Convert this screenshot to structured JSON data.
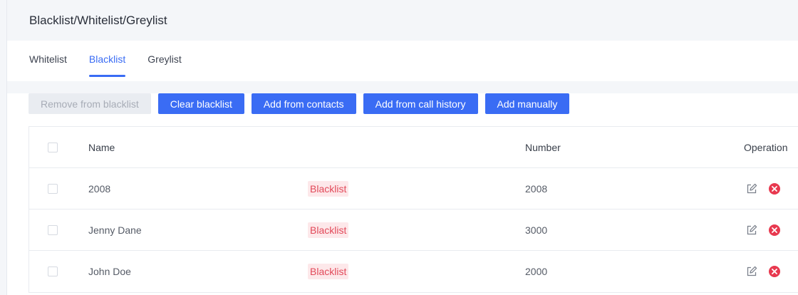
{
  "header": {
    "title": "Blacklist/Whitelist/Greylist"
  },
  "tabs": [
    {
      "label": "Whitelist",
      "active": false
    },
    {
      "label": "Blacklist",
      "active": true
    },
    {
      "label": "Greylist",
      "active": false
    }
  ],
  "toolbar": {
    "remove_label": "Remove from blacklist",
    "clear_label": "Clear blacklist",
    "add_contacts_label": "Add from contacts",
    "add_history_label": "Add from call history",
    "add_manual_label": "Add manually"
  },
  "table": {
    "columns": {
      "name": "Name",
      "number": "Number",
      "operation": "Operation"
    },
    "rows": [
      {
        "name": "2008",
        "tag": "Blacklist",
        "number": "2008"
      },
      {
        "name": "Jenny Dane",
        "tag": "Blacklist",
        "number": "3000"
      },
      {
        "name": "John Doe",
        "tag": "Blacklist",
        "number": "2000"
      }
    ]
  },
  "icons": {
    "edit": "edit-icon",
    "delete": "delete-icon"
  },
  "colors": {
    "accent": "#3a6cf4",
    "danger": "#e8394f",
    "tag_bg": "#fde8ea"
  }
}
